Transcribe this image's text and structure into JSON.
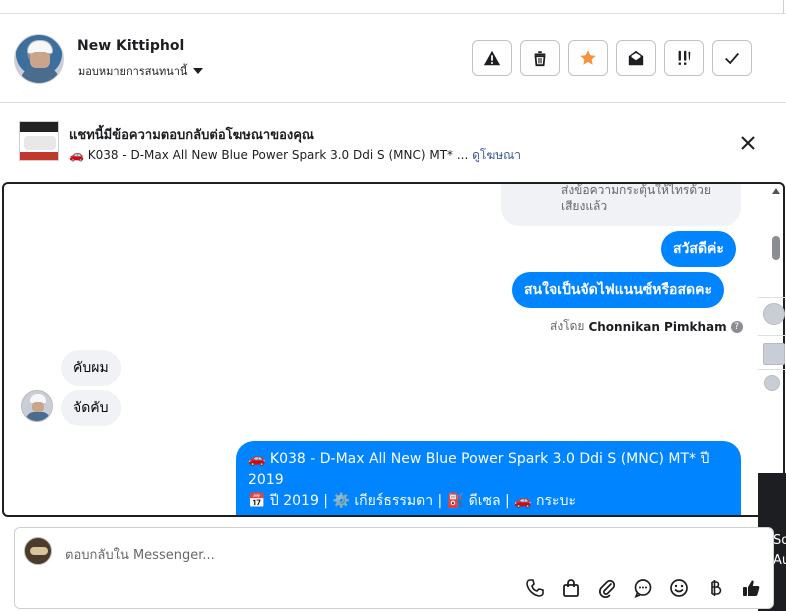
{
  "contact": {
    "name": "New Kittiphol",
    "assign_label": "มอบหมายการสนทนานี้"
  },
  "actions": [
    {
      "name": "mark-spam-button",
      "icon": "warning-icon"
    },
    {
      "name": "delete-button",
      "icon": "trash-icon"
    },
    {
      "name": "star-button",
      "icon": "star-icon",
      "color": "#f7923a"
    },
    {
      "name": "mark-unread-button",
      "icon": "envelope-open-icon"
    },
    {
      "name": "follow-up-button",
      "icon": "follow-up-icon"
    },
    {
      "name": "mark-done-button",
      "icon": "check-icon"
    }
  ],
  "ad_banner": {
    "title": "แชทนี้มีข้อความตอบกลับต่อโฆษณาของคุณ",
    "subtitle": "🚗 K038 - D-Max All New Blue Power Spark 3.0 Ddi S (MNC) MT* ...",
    "view_ad_label": "ดูโฆษณา"
  },
  "messages": {
    "gray_top": "ส่งข้อความกระตุ้นให้ไทรด้วยเสียงแล้ว",
    "greeting": "สวัสดีค่ะ",
    "question": "สนใจเป็นจัดไฟแนนซ์หรือสดคะ",
    "sent_by_prefix": "ส่งโดย",
    "sent_by_name": "Chonnikan Pimkham",
    "reply_1": "คับผม",
    "reply_2": "จัดคับ",
    "ad_card_line1": "🚗 K038 - D-Max All New Blue Power Spark 3.0 Ddi S (MNC) MT* ปี 2019",
    "ad_card_line2": "📅 ปี 2019 | ⚙️ เกียร์ธรรมดา | ⛽ ดีเซล | 🚗 กระบะ"
  },
  "side_panel": {
    "text_1": "So",
    "text_2": "Au"
  },
  "composer": {
    "placeholder": "ตอบกลับใน Messenger...",
    "tools": [
      "phone-icon",
      "shopping-bag-icon",
      "paperclip-icon",
      "chat-bubble-icon",
      "emoji-icon",
      "baht-icon",
      "thumbs-up-icon"
    ]
  }
}
